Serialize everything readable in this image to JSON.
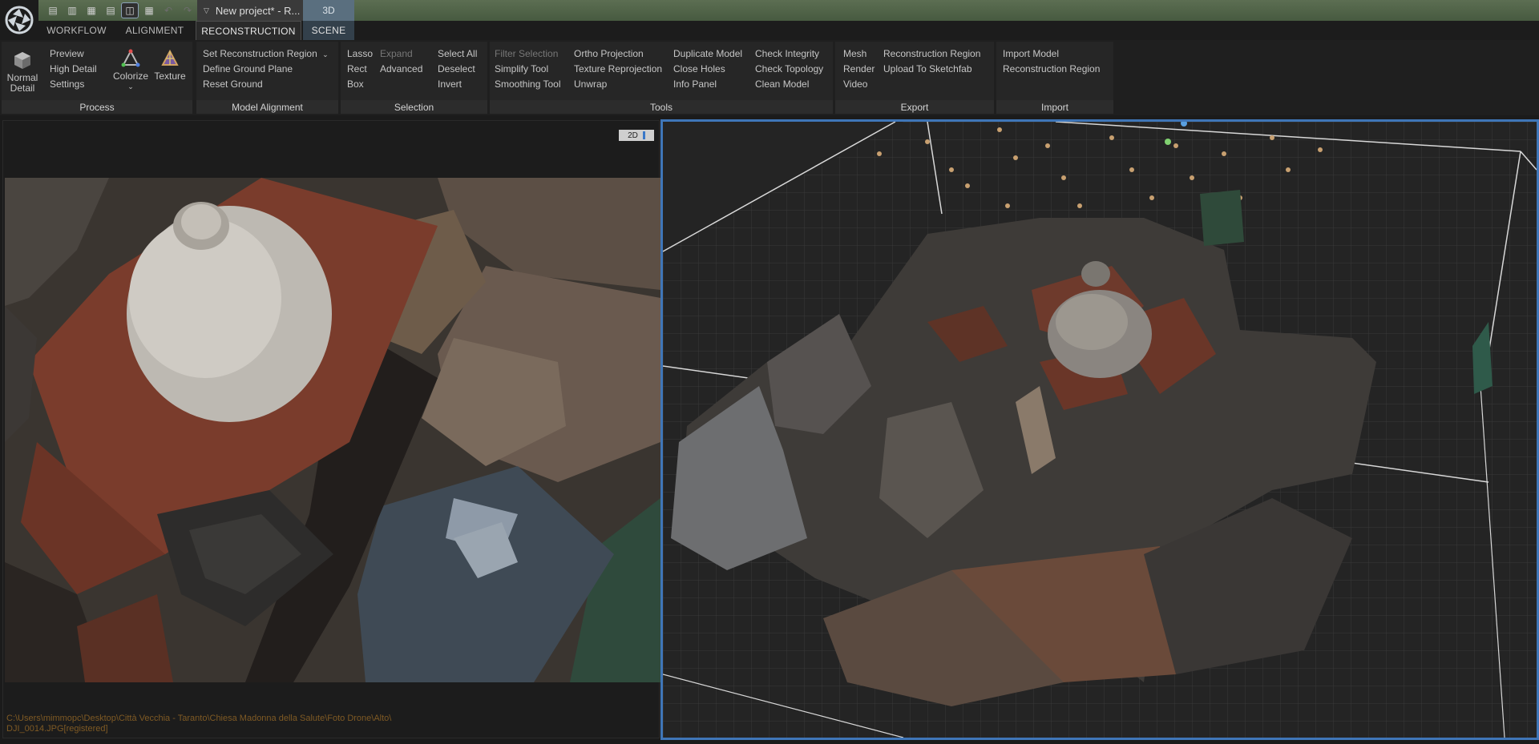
{
  "titlebar": {
    "project_title": "New project* - R...",
    "view_tab": "3D"
  },
  "ribbon_tabs": {
    "workflow": "WORKFLOW",
    "alignment": "ALIGNMENT",
    "reconstruction": "RECONSTRUCTION",
    "scene": "SCENE"
  },
  "process": {
    "normal_detail": "Normal Detail",
    "preview": "Preview",
    "high_detail": "High Detail",
    "settings": "Settings",
    "colorize": "Colorize",
    "texture": "Texture",
    "label": "Process"
  },
  "model_alignment": {
    "set_region": "Set Reconstruction Region",
    "define_ground": "Define Ground Plane",
    "reset_ground": "Reset Ground",
    "label": "Model Alignment"
  },
  "selection": {
    "lasso": "Lasso",
    "rect": "Rect",
    "box": "Box",
    "expand": "Expand",
    "advanced": "Advanced",
    "select_all": "Select All",
    "deselect": "Deselect",
    "invert": "Invert",
    "label": "Selection"
  },
  "tools": {
    "filter_selection": "Filter Selection",
    "simplify": "Simplify Tool",
    "smoothing": "Smoothing Tool",
    "ortho": "Ortho Projection",
    "texture_reprojection": "Texture Reprojection",
    "unwrap": "Unwrap",
    "duplicate": "Duplicate Model",
    "close_holes": "Close Holes",
    "info_panel": "Info Panel",
    "check_integrity": "Check Integrity",
    "check_topology": "Check Topology",
    "clean_model": "Clean Model",
    "label": "Tools"
  },
  "export": {
    "mesh": "Mesh",
    "render": "Render",
    "video": "Video",
    "reconstruction_region": "Reconstruction Region",
    "upload": "Upload To Sketchfab",
    "label": "Export"
  },
  "import": {
    "import_model": "Import Model",
    "reconstruction_region": "Reconstruction Region",
    "label": "Import"
  },
  "viewer": {
    "toggle_2d": "2D",
    "path_line1": "C:\\Users\\mimmopc\\Desktop\\Città Vecchia - Taranto\\Chiesa Madonna della Salute\\Foto Drone\\Alto\\",
    "path_line2": "DJI_0014.JPG[registered]"
  },
  "colors": {
    "titlebar": "#516349",
    "accent_blue": "#3f76b8",
    "path_text": "#7f5a24"
  }
}
